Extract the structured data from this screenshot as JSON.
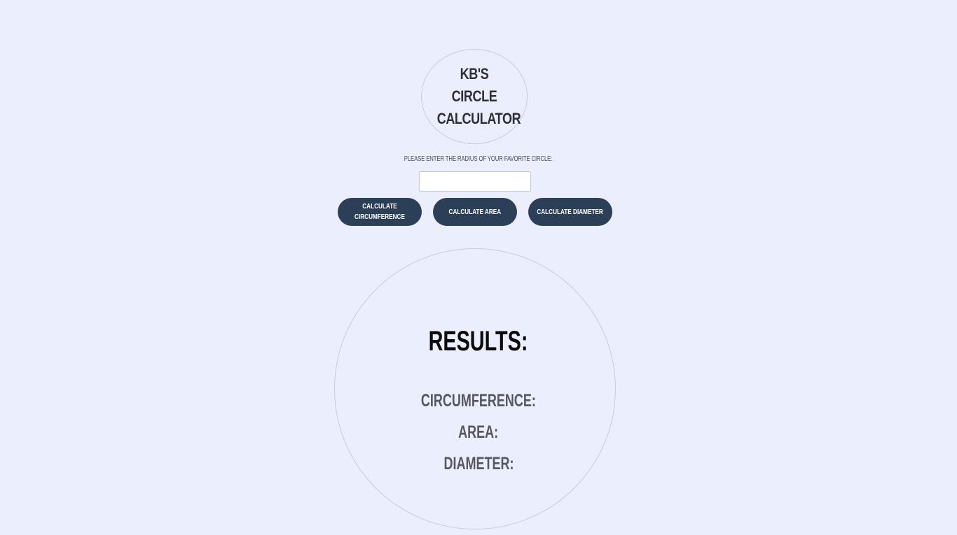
{
  "header": {
    "title_line1": "KB's Circle",
    "title_line2": "Calculator"
  },
  "form": {
    "prompt": "Please enter the radius of your favorite circle:",
    "radius_value": "",
    "radius_placeholder": ""
  },
  "buttons": {
    "circumference": "Calculate Circumference",
    "area": "Calculate Area",
    "diameter": "Calculate Diameter"
  },
  "results": {
    "heading": "Results:",
    "circumference_label": "Circumference:",
    "area_label": "Area:",
    "diameter_label": "Diameter:"
  },
  "colors": {
    "background": "#ebeefd",
    "button": "#2b4057",
    "button_text": "#ffffff",
    "circle_border": "#c9ccd8",
    "heading_text": "#0a0a0a",
    "result_text": "#555860"
  }
}
